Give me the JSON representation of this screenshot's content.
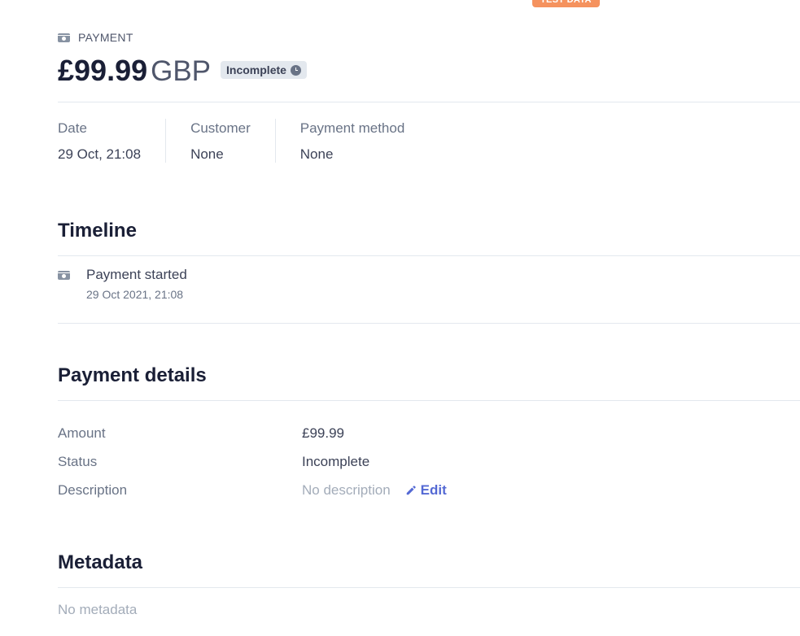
{
  "test_badge": "TEST DATA",
  "header": {
    "kind_label": "PAYMENT",
    "amount": "£99.99",
    "currency": "GBP",
    "status_pill": "Incomplete"
  },
  "summary": [
    {
      "label": "Date",
      "value": "29 Oct, 21:08"
    },
    {
      "label": "Customer",
      "value": "None"
    },
    {
      "label": "Payment method",
      "value": "None"
    }
  ],
  "timeline": {
    "title": "Timeline",
    "items": [
      {
        "title": "Payment started",
        "date": "29 Oct 2021, 21:08"
      }
    ]
  },
  "payment_details": {
    "title": "Payment details",
    "rows": [
      {
        "label": "Amount",
        "value": "£99.99"
      },
      {
        "label": "Status",
        "value": "Incomplete"
      },
      {
        "label": "Description",
        "value": "No description"
      }
    ],
    "edit_label": "Edit"
  },
  "metadata": {
    "title": "Metadata",
    "empty": "No metadata"
  },
  "colors": {
    "accent": "#5469d4",
    "test_badge": "#f5925e",
    "pill_bg": "#e3e8ee"
  }
}
